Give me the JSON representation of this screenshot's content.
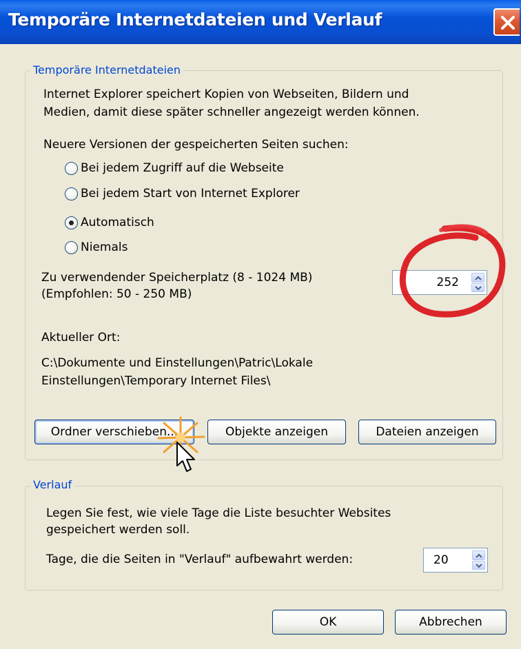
{
  "window": {
    "title": "Temporäre Internetdateien und Verlauf"
  },
  "temp_files": {
    "legend": "Temporäre Internetdateien",
    "description_line1": "Internet Explorer speichert Kopien von Webseiten, Bildern und",
    "description_line2": "Medien, damit diese später schneller angezeigt werden können.",
    "check_label": "Neuere Versionen der gespeicherten Seiten suchen:",
    "options": [
      {
        "label": "Bei jedem Zugriff auf die Webseite",
        "checked": false
      },
      {
        "label": "Bei jedem Start von Internet Explorer",
        "checked": false
      },
      {
        "label": "Automatisch",
        "checked": true
      },
      {
        "label": "Niemals",
        "checked": false
      }
    ],
    "space_label_line1": "Zu verwendender Speicherplatz (8 - 1024 MB)",
    "space_label_line2": "(Empfohlen: 50 - 250 MB)",
    "space_value": "252",
    "location_label": "Aktueller Ort:",
    "location_line1": "C:\\Dokumente und Einstellungen\\Patric\\Lokale",
    "location_line2": "Einstellungen\\Temporary Internet Files\\",
    "buttons": {
      "move": "Ordner verschieben...",
      "objects": "Objekte anzeigen",
      "files": "Dateien anzeigen"
    }
  },
  "history": {
    "legend": "Verlauf",
    "description_line1": "Legen Sie fest, wie viele Tage die Liste besuchter Websites",
    "description_line2": "gespeichert werden soll.",
    "days_label": "Tage, die die Seiten in \"Verlauf\" aufbewahrt werden:",
    "days_value": "20"
  },
  "footer": {
    "ok": "OK",
    "cancel": "Abbrechen"
  },
  "colors": {
    "title_bar": "#0a4fd0",
    "legend": "#0046d5",
    "annotation": "#d9141a"
  }
}
